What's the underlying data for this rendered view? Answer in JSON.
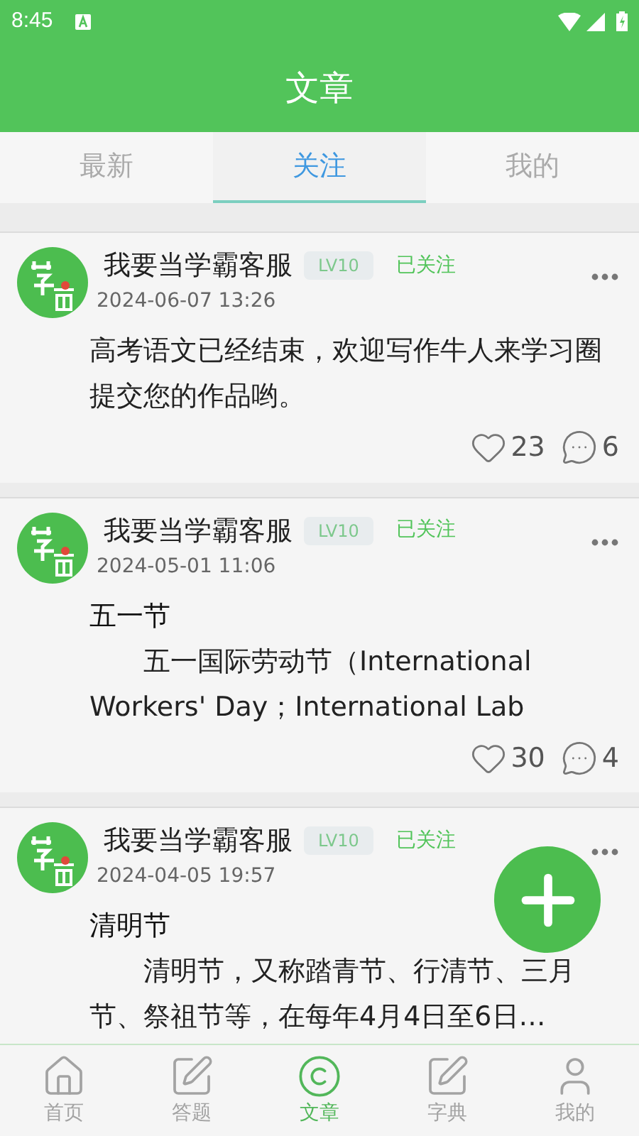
{
  "status_bar": {
    "time": "8:45"
  },
  "header": {
    "title": "文章"
  },
  "tabs": [
    {
      "label": "最新",
      "selected": false
    },
    {
      "label": "关注",
      "selected": true
    },
    {
      "label": "我的",
      "selected": false
    }
  ],
  "posts": [
    {
      "author": "我要当学霸客服",
      "level_badge": "LV10",
      "follow_status": "已关注",
      "time": "2024-06-07 13:26",
      "body": "高考语文已经结束，欢迎写作牛人来学习圈提交您的作品哟。",
      "likes": "23",
      "comments": "6"
    },
    {
      "author": "我要当学霸客服",
      "level_badge": "LV10",
      "follow_status": "已关注",
      "time": "2024-05-01 11:06",
      "title": "五一节",
      "body": "　　五一国际劳动节（International Workers' Day；International Lab",
      "likes": "30",
      "comments": "4"
    },
    {
      "author": "我要当学霸客服",
      "level_badge": "LV10",
      "follow_status": "已关注",
      "time": "2024-04-05 19:57",
      "title": "清明节",
      "body": "　　清明节，又称踏青节、行清节、三月节、祭祖节等，在每年4月4日至6日…"
    }
  ],
  "bottom_nav": [
    {
      "label": "首页",
      "selected": false
    },
    {
      "label": "答题",
      "selected": false
    },
    {
      "label": "文章",
      "selected": true
    },
    {
      "label": "字典",
      "selected": false
    },
    {
      "label": "我的",
      "selected": false
    }
  ]
}
